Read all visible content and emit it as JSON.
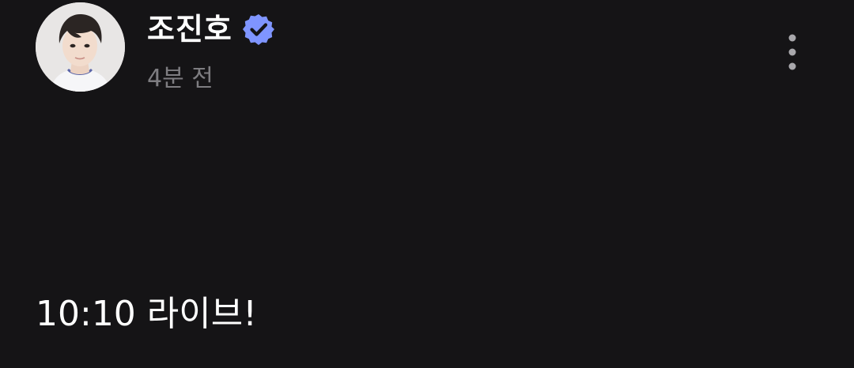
{
  "post": {
    "author": {
      "name": "조진호",
      "verified": true,
      "verified_badge_color": "#7f95ff",
      "avatar_icon": "profile-photo"
    },
    "timestamp": "4분 전",
    "menu_icon": "more-vertical-icon",
    "body": "10:10 라이브!"
  },
  "colors": {
    "background": "#151416",
    "primary_text": "#ffffff",
    "secondary_text": "#7e7d81"
  }
}
